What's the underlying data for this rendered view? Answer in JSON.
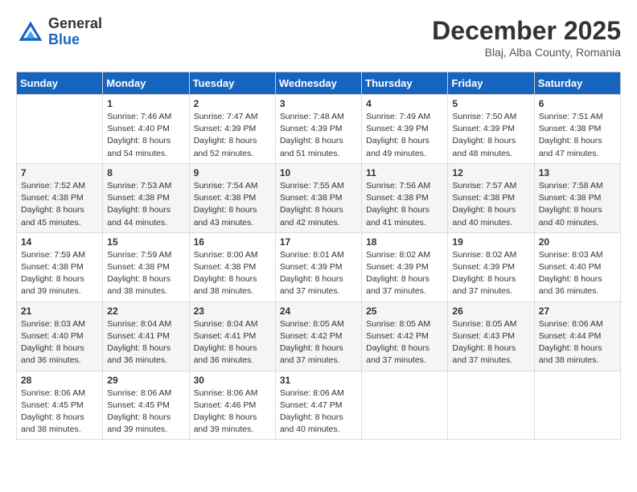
{
  "logo": {
    "general": "General",
    "blue": "Blue"
  },
  "title": "December 2025",
  "location": "Blaj, Alba County, Romania",
  "days_of_week": [
    "Sunday",
    "Monday",
    "Tuesday",
    "Wednesday",
    "Thursday",
    "Friday",
    "Saturday"
  ],
  "weeks": [
    [
      {
        "day": "",
        "sunrise": "",
        "sunset": "",
        "daylight": ""
      },
      {
        "day": "1",
        "sunrise": "Sunrise: 7:46 AM",
        "sunset": "Sunset: 4:40 PM",
        "daylight": "Daylight: 8 hours and 54 minutes."
      },
      {
        "day": "2",
        "sunrise": "Sunrise: 7:47 AM",
        "sunset": "Sunset: 4:39 PM",
        "daylight": "Daylight: 8 hours and 52 minutes."
      },
      {
        "day": "3",
        "sunrise": "Sunrise: 7:48 AM",
        "sunset": "Sunset: 4:39 PM",
        "daylight": "Daylight: 8 hours and 51 minutes."
      },
      {
        "day": "4",
        "sunrise": "Sunrise: 7:49 AM",
        "sunset": "Sunset: 4:39 PM",
        "daylight": "Daylight: 8 hours and 49 minutes."
      },
      {
        "day": "5",
        "sunrise": "Sunrise: 7:50 AM",
        "sunset": "Sunset: 4:39 PM",
        "daylight": "Daylight: 8 hours and 48 minutes."
      },
      {
        "day": "6",
        "sunrise": "Sunrise: 7:51 AM",
        "sunset": "Sunset: 4:38 PM",
        "daylight": "Daylight: 8 hours and 47 minutes."
      }
    ],
    [
      {
        "day": "7",
        "sunrise": "Sunrise: 7:52 AM",
        "sunset": "Sunset: 4:38 PM",
        "daylight": "Daylight: 8 hours and 45 minutes."
      },
      {
        "day": "8",
        "sunrise": "Sunrise: 7:53 AM",
        "sunset": "Sunset: 4:38 PM",
        "daylight": "Daylight: 8 hours and 44 minutes."
      },
      {
        "day": "9",
        "sunrise": "Sunrise: 7:54 AM",
        "sunset": "Sunset: 4:38 PM",
        "daylight": "Daylight: 8 hours and 43 minutes."
      },
      {
        "day": "10",
        "sunrise": "Sunrise: 7:55 AM",
        "sunset": "Sunset: 4:38 PM",
        "daylight": "Daylight: 8 hours and 42 minutes."
      },
      {
        "day": "11",
        "sunrise": "Sunrise: 7:56 AM",
        "sunset": "Sunset: 4:38 PM",
        "daylight": "Daylight: 8 hours and 41 minutes."
      },
      {
        "day": "12",
        "sunrise": "Sunrise: 7:57 AM",
        "sunset": "Sunset: 4:38 PM",
        "daylight": "Daylight: 8 hours and 40 minutes."
      },
      {
        "day": "13",
        "sunrise": "Sunrise: 7:58 AM",
        "sunset": "Sunset: 4:38 PM",
        "daylight": "Daylight: 8 hours and 40 minutes."
      }
    ],
    [
      {
        "day": "14",
        "sunrise": "Sunrise: 7:59 AM",
        "sunset": "Sunset: 4:38 PM",
        "daylight": "Daylight: 8 hours and 39 minutes."
      },
      {
        "day": "15",
        "sunrise": "Sunrise: 7:59 AM",
        "sunset": "Sunset: 4:38 PM",
        "daylight": "Daylight: 8 hours and 38 minutes."
      },
      {
        "day": "16",
        "sunrise": "Sunrise: 8:00 AM",
        "sunset": "Sunset: 4:38 PM",
        "daylight": "Daylight: 8 hours and 38 minutes."
      },
      {
        "day": "17",
        "sunrise": "Sunrise: 8:01 AM",
        "sunset": "Sunset: 4:39 PM",
        "daylight": "Daylight: 8 hours and 37 minutes."
      },
      {
        "day": "18",
        "sunrise": "Sunrise: 8:02 AM",
        "sunset": "Sunset: 4:39 PM",
        "daylight": "Daylight: 8 hours and 37 minutes."
      },
      {
        "day": "19",
        "sunrise": "Sunrise: 8:02 AM",
        "sunset": "Sunset: 4:39 PM",
        "daylight": "Daylight: 8 hours and 37 minutes."
      },
      {
        "day": "20",
        "sunrise": "Sunrise: 8:03 AM",
        "sunset": "Sunset: 4:40 PM",
        "daylight": "Daylight: 8 hours and 36 minutes."
      }
    ],
    [
      {
        "day": "21",
        "sunrise": "Sunrise: 8:03 AM",
        "sunset": "Sunset: 4:40 PM",
        "daylight": "Daylight: 8 hours and 36 minutes."
      },
      {
        "day": "22",
        "sunrise": "Sunrise: 8:04 AM",
        "sunset": "Sunset: 4:41 PM",
        "daylight": "Daylight: 8 hours and 36 minutes."
      },
      {
        "day": "23",
        "sunrise": "Sunrise: 8:04 AM",
        "sunset": "Sunset: 4:41 PM",
        "daylight": "Daylight: 8 hours and 36 minutes."
      },
      {
        "day": "24",
        "sunrise": "Sunrise: 8:05 AM",
        "sunset": "Sunset: 4:42 PM",
        "daylight": "Daylight: 8 hours and 37 minutes."
      },
      {
        "day": "25",
        "sunrise": "Sunrise: 8:05 AM",
        "sunset": "Sunset: 4:42 PM",
        "daylight": "Daylight: 8 hours and 37 minutes."
      },
      {
        "day": "26",
        "sunrise": "Sunrise: 8:05 AM",
        "sunset": "Sunset: 4:43 PM",
        "daylight": "Daylight: 8 hours and 37 minutes."
      },
      {
        "day": "27",
        "sunrise": "Sunrise: 8:06 AM",
        "sunset": "Sunset: 4:44 PM",
        "daylight": "Daylight: 8 hours and 38 minutes."
      }
    ],
    [
      {
        "day": "28",
        "sunrise": "Sunrise: 8:06 AM",
        "sunset": "Sunset: 4:45 PM",
        "daylight": "Daylight: 8 hours and 38 minutes."
      },
      {
        "day": "29",
        "sunrise": "Sunrise: 8:06 AM",
        "sunset": "Sunset: 4:45 PM",
        "daylight": "Daylight: 8 hours and 39 minutes."
      },
      {
        "day": "30",
        "sunrise": "Sunrise: 8:06 AM",
        "sunset": "Sunset: 4:46 PM",
        "daylight": "Daylight: 8 hours and 39 minutes."
      },
      {
        "day": "31",
        "sunrise": "Sunrise: 8:06 AM",
        "sunset": "Sunset: 4:47 PM",
        "daylight": "Daylight: 8 hours and 40 minutes."
      },
      {
        "day": "",
        "sunrise": "",
        "sunset": "",
        "daylight": ""
      },
      {
        "day": "",
        "sunrise": "",
        "sunset": "",
        "daylight": ""
      },
      {
        "day": "",
        "sunrise": "",
        "sunset": "",
        "daylight": ""
      }
    ]
  ]
}
